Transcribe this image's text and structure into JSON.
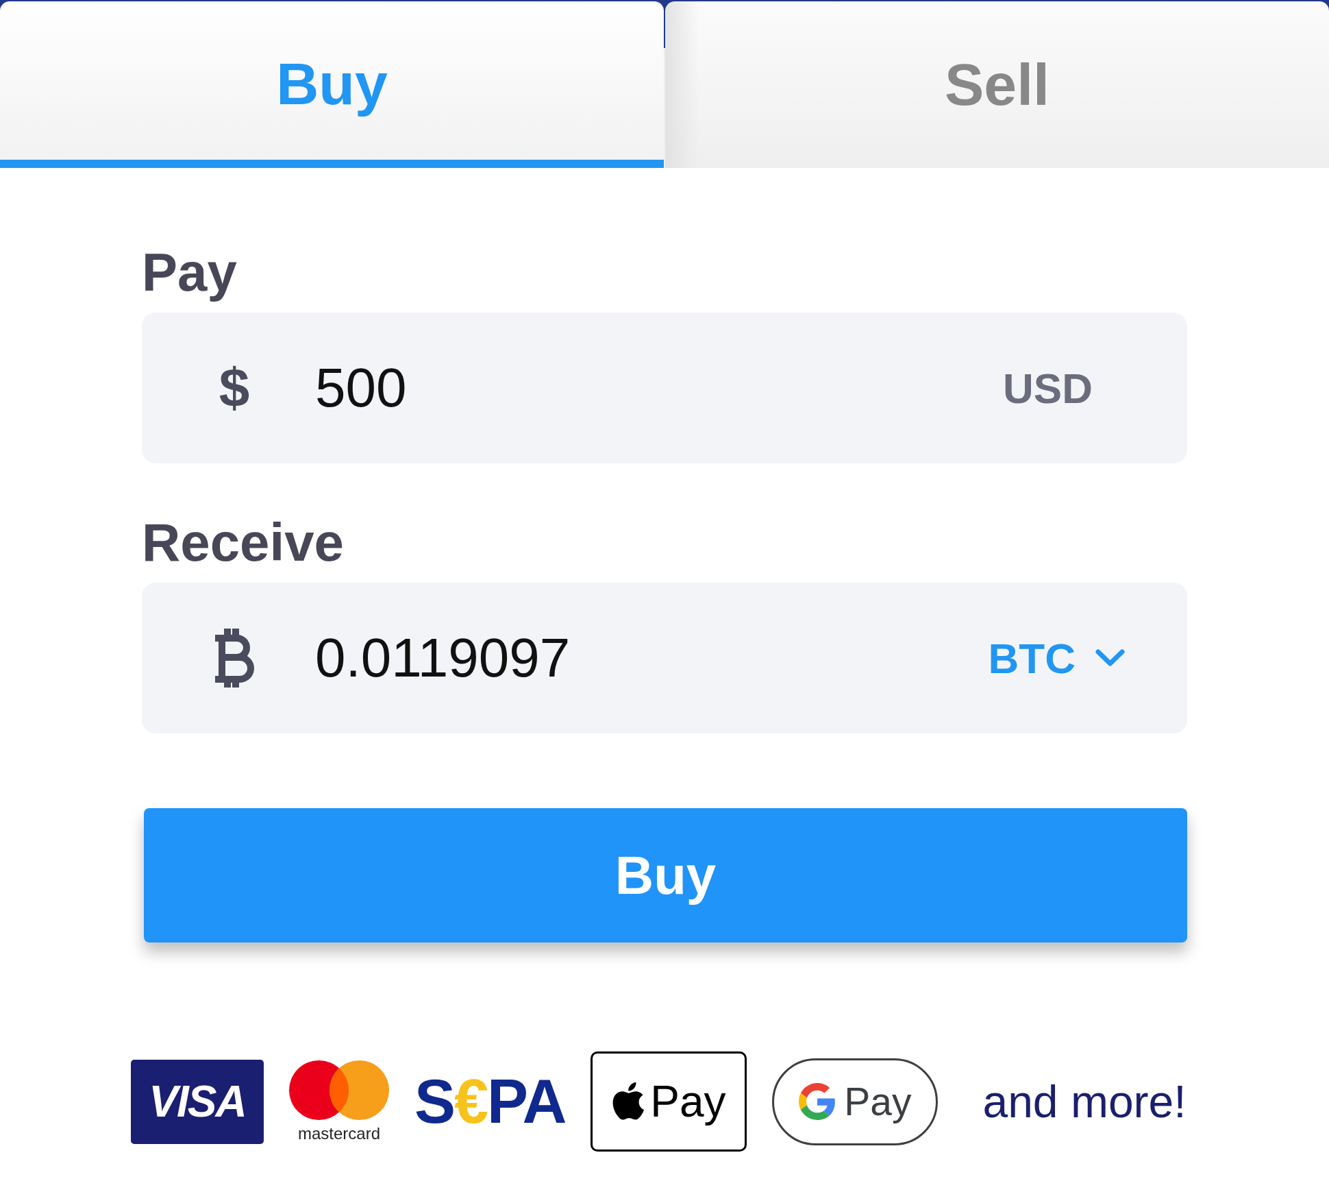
{
  "tabs": [
    {
      "label": "Buy",
      "selected": true
    },
    {
      "label": "Sell",
      "selected": false
    }
  ],
  "fields": [
    {
      "label": "Pay",
      "symbol": "$",
      "value": "500",
      "currency": "USD",
      "kind": "static"
    },
    {
      "label": "Receive",
      "value": "0.0119097",
      "currency": "BTC",
      "kind": "dropdown"
    }
  ],
  "button": "Buy",
  "payment_methods": [
    {
      "kind": "visa",
      "text": "VISA"
    },
    {
      "kind": "mastercard",
      "text": "mastercard"
    },
    {
      "kind": "sepa",
      "text": "S€PA"
    },
    {
      "kind": "apple_pay",
      "text": "Pay"
    },
    {
      "kind": "google_pay",
      "text": "Pay"
    }
  ],
  "more": "and more!"
}
